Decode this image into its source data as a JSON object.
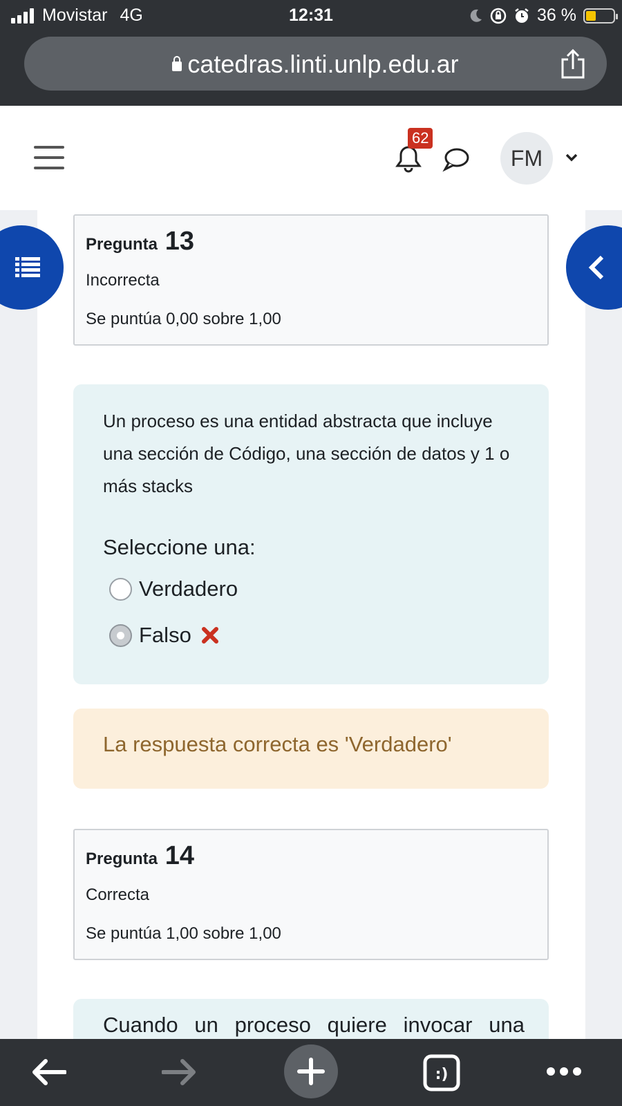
{
  "status_bar": {
    "carrier": "Movistar",
    "network": "4G",
    "time": "12:31",
    "battery_text": "36 %",
    "battery_level": 0.36,
    "battery_color": "#f5c400"
  },
  "browser": {
    "url": "catedras.linti.unlp.edu.ar",
    "icons": [
      "lock-icon",
      "share-icon",
      "back-arrow-icon",
      "forward-arrow-icon",
      "plus-icon",
      "tabs-icon",
      "more-icon"
    ]
  },
  "header": {
    "notification_count": "62",
    "user_initials": "FM",
    "icons": [
      "menu-icon",
      "bell-icon",
      "chat-icon",
      "chevron-down-icon"
    ]
  },
  "question13": {
    "label": "Pregunta",
    "number": "13",
    "state": "Incorrecta",
    "grade": "Se puntúa 0,00 sobre 1,00",
    "text": "Un proceso es una entidad abstracta que incluye una sección de Código, una sección de datos y 1 o más stacks",
    "prompt": "Seleccione una:",
    "options": [
      {
        "label": "Verdadero",
        "selected": false
      },
      {
        "label": "Falso",
        "selected": true,
        "marked_incorrect": true
      }
    ],
    "feedback": "La respuesta correcta es 'Verdadero'"
  },
  "question14": {
    "label": "Pregunta",
    "number": "14",
    "state": "Correcta",
    "grade": "Se puntúa 1,00 sobre 1,00",
    "text_partial": "Cuando un proceso quiere invocar una"
  },
  "colors": {
    "accent": "#0f47ad",
    "badge": "#ca3120",
    "incorrect": "#ca3120",
    "feedback_text": "#8e662e"
  }
}
